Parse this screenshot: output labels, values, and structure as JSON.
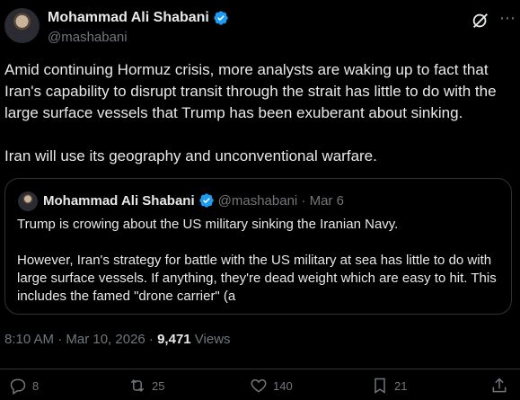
{
  "author": {
    "name": "Mohammad Ali Shabani",
    "handle": "@mashabani"
  },
  "tweet": {
    "text": "Amid continuing Hormuz crisis, more analysts are waking up to fact that Iran's capability to disrupt transit through the strait has little to do with the large surface vessels that Trump has been exuberant about sinking.\n\nIran will use its geography and unconventional warfare."
  },
  "quote": {
    "name": "Mohammad Ali Shabani",
    "handle_date": "@mashabani · Mar 6",
    "text": "Trump is crowing about the US military sinking the Iranian Navy.\n\nHowever, Iran's strategy for battle with the US military at sea has little to do with large surface vessels. If anything, they're dead weight which are easy to hit. This includes the famed \"drone carrier\" (a"
  },
  "meta": {
    "time_date": "8:10 AM · Mar 10, 2026 · ",
    "views_count": "9,471",
    "views_label": " Views"
  },
  "actions": {
    "replies": "8",
    "reposts": "25",
    "likes": "140",
    "bookmarks": "21"
  },
  "colors": {
    "background": "#000000",
    "text": "#e7e9ea",
    "muted": "#71767b",
    "border": "#2f3336",
    "verified": "#1d9bf0"
  }
}
